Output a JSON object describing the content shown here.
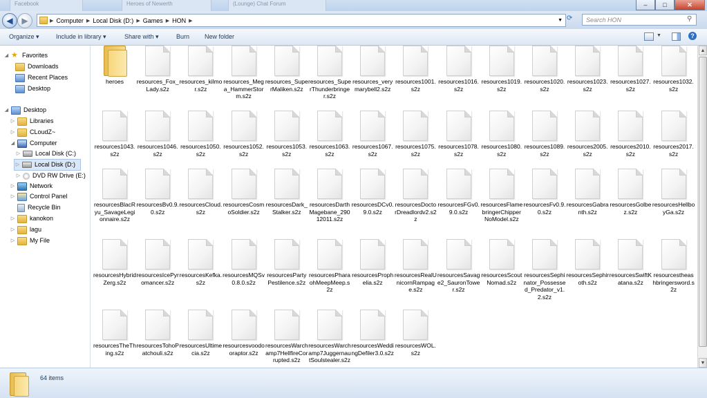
{
  "window": {
    "tabs": [
      "Facebook",
      "Heroes of Newerth",
      "(Lounge) Chat Forum"
    ],
    "controls": [
      "–",
      "□",
      "✕"
    ]
  },
  "address": {
    "crumbs": [
      "Computer",
      "Local Disk (D:)",
      "Games",
      "HON"
    ],
    "search_placeholder": "Search HON"
  },
  "toolbar": {
    "organize": "Organize ▾",
    "include": "Include in library ▾",
    "share": "Share with ▾",
    "burn": "Burn",
    "new_folder": "New folder"
  },
  "nav": {
    "items": [
      {
        "label": "Favorites",
        "icon": "star-icon"
      },
      {
        "label": "Downloads",
        "icon": "downloads-icon"
      },
      {
        "label": "Recent Places",
        "icon": "recent-places-icon"
      },
      {
        "label": "Desktop",
        "icon": "desktop-icon"
      },
      {
        "label": "Desktop",
        "icon": "desktop-icon"
      },
      {
        "label": "Libraries",
        "icon": "libraries-icon"
      },
      {
        "label": "CLoudZ~",
        "icon": "user-folder-icon"
      },
      {
        "label": "Computer",
        "icon": "computer-icon"
      },
      {
        "label": "Local Disk (C:)",
        "icon": "drive-icon"
      },
      {
        "label": "Local Disk (D:)",
        "icon": "drive-icon"
      },
      {
        "label": "DVD RW Drive (E:)",
        "icon": "dvd-icon"
      },
      {
        "label": "Network",
        "icon": "network-icon"
      },
      {
        "label": "Control Panel",
        "icon": "control-panel-icon"
      },
      {
        "label": "Recycle Bin",
        "icon": "recycle-bin-icon"
      },
      {
        "label": "kanokon",
        "icon": "folder-icon"
      },
      {
        "label": "lagu",
        "icon": "folder-icon"
      },
      {
        "label": "My File",
        "icon": "folder-icon"
      }
    ]
  },
  "files": [
    "heroes",
    "resources_Fox_Lady.s2z",
    "resources_kilmor.s2z",
    "resources_Mega_HammerStorm.s2z",
    "resources_SuperMaliken.s2z",
    "resources_SuperThunderbringer.s2z",
    "resources_verymarybell2.s2z",
    "resources1001.s2z",
    "resources1016.s2z",
    "resources1019.s2z",
    "resources1020.s2z",
    "resources1023.s2z",
    "resources1027.s2z",
    "resources1032.s2z",
    "resources1043.s2z",
    "resources1046.s2z",
    "resources1050.s2z",
    "resources1052.s2z",
    "resources1053.s2z",
    "resources1063.s2z",
    "resources1067.s2z",
    "resources1075.s2z",
    "resources1078.s2z",
    "resources1080.s2z",
    "resources1089.s2z",
    "resources2005.s2z",
    "resources2010.s2z",
    "resources2017.s2z",
    "resourcesBlacRyu_SavageLegionnaire.s2z",
    "resourcesBv0.9.0.s2z",
    "resourcesCloud.s2z",
    "resourcesCosmoSoldier.s2z",
    "resourcesDark_Stalker.s2z",
    "resourcesDarthMagebane_29012011.s2z",
    "resourcesDCv0.9.0.s2z",
    "resourcesDoctorDreadlordv2.s2z",
    "resourcesFGv0.9.0.s2z",
    "resourcesFlamebringerChipperNoModel.s2z",
    "resourcesFv0.9.0.s2z",
    "resourcesGabranth.s2z",
    "resourcesGolbez.s2z",
    "resourcesHellboyGa.s2z",
    "resourcesHybridZerg.s2z",
    "resourcesIcePyromancer.s2z",
    "resourcesKefka.s2z",
    "resourcesMQSv0.8.0.s2z",
    "resourcesPartyPestilence.s2z",
    "resourcesPharaohMeepMeep.s2z",
    "resourcesProphelia.s2z",
    "resourcesRealUnicornRampage.s2z",
    "resourcesSavage2_SauronTower.s2z",
    "resourcesScoutNomad.s2z",
    "resourcesSephinator_Possessed_Predator_v1.2.s2z",
    "resourcesSephiroth.s2z",
    "resourcesSwiftKatana.s2z",
    "resourcestheashbringersword.s2z",
    "resourcesTheThing.s2z",
    "resourcesTohoPatchouli.s2z",
    "resourcesUltimecia.s2z",
    "resourcesvoodooraptor.s2z",
    "resourcesWarchamp7HellfireCorrupted.s2z",
    "resourcesWarchamp7JuggernautSoulstealer.s2z",
    "resourcesWeddingDefiler3.0.s2z",
    "resourcesWOL.s2z"
  ],
  "details": {
    "count_label": "64 items"
  }
}
